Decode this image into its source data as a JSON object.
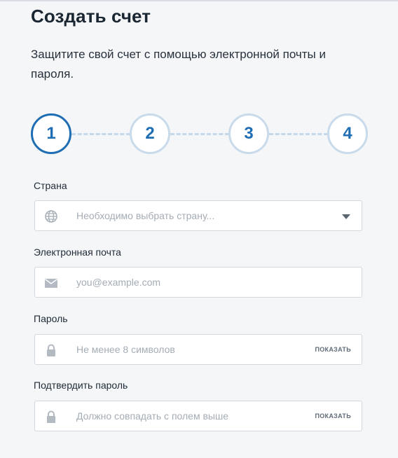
{
  "header": {
    "title": "Создать счет",
    "subtitle": "Защитите свой счет с помощью электронной почты и пароля."
  },
  "stepper": {
    "steps": [
      "1",
      "2",
      "3",
      "4"
    ],
    "active_step": 1,
    "colors": {
      "active_border": "#1f6eb4",
      "inactive_border": "#c9dbeb",
      "number": "#1f6eb4"
    }
  },
  "form": {
    "country": {
      "label": "Страна",
      "placeholder": "Необходимо выбрать страну...",
      "value": "",
      "icon": "globe-icon"
    },
    "email": {
      "label": "Электронная почта",
      "placeholder": "you@example.com",
      "value": "",
      "icon": "envelope-icon"
    },
    "password": {
      "label": "Пароль",
      "placeholder": "Не менее 8 символов",
      "value": "",
      "icon": "lock-icon",
      "show_label": "ПОКАЗАТЬ"
    },
    "confirm_password": {
      "label": "Подтвердить пароль",
      "placeholder": "Должно совпадать с полем выше",
      "value": "",
      "icon": "lock-icon",
      "show_label": "ПОКАЗАТЬ"
    }
  }
}
